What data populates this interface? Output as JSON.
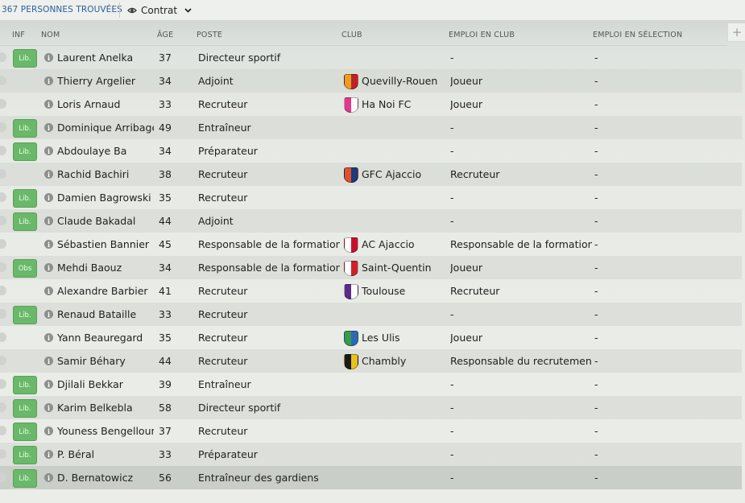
{
  "header": {
    "count_label": "367 PERSONNES TROUVÉES",
    "view_label": "Contrat",
    "add_column": "+"
  },
  "columns": {
    "inf": "INF",
    "nom": "NOM",
    "age": "ÂGE",
    "poste": "POSTE",
    "club": "CLUB",
    "emploi_club": "EMPLOI EN CLUB",
    "emploi_selection": "EMPLOI EN SÉLECTION"
  },
  "people": [
    {
      "badge": "Lib.",
      "name": "Laurent Anelka",
      "age": "37",
      "role": "Directeur sportif",
      "club": "",
      "club_icon": "",
      "club_colors": [],
      "club_job": "-",
      "nat_job": "-"
    },
    {
      "badge": "",
      "name": "Thierry Argelier",
      "age": "34",
      "role": "Adjoint",
      "club": "Quevilly-Rouen",
      "club_icon": "quevilly-rouen-crest-icon",
      "club_colors": [
        "#e8a020",
        "#c0202a"
      ],
      "club_job": "Joueur",
      "nat_job": "-"
    },
    {
      "badge": "",
      "name": "Loris Arnaud",
      "age": "33",
      "role": "Recruteur",
      "club": "Ha Noi FC",
      "club_icon": "ha-noi-fc-crest-icon",
      "club_colors": [
        "#e23a8a",
        "#ffffff"
      ],
      "club_job": "Joueur",
      "nat_job": "-"
    },
    {
      "badge": "Lib.",
      "name": "Dominique Arribagé",
      "age": "49",
      "role": "Entraîneur",
      "club": "",
      "club_icon": "",
      "club_colors": [],
      "club_job": "-",
      "nat_job": "-"
    },
    {
      "badge": "Lib.",
      "name": "Abdoulaye Ba",
      "age": "34",
      "role": "Préparateur",
      "club": "",
      "club_icon": "",
      "club_colors": [],
      "club_job": "-",
      "nat_job": "-"
    },
    {
      "badge": "",
      "name": "Rachid Bachiri",
      "age": "38",
      "role": "Recruteur",
      "club": "GFC Ajaccio",
      "club_icon": "gfc-ajaccio-crest-icon",
      "club_colors": [
        "#e0502a",
        "#1d3b7a"
      ],
      "club_job": "Recruteur",
      "nat_job": "-"
    },
    {
      "badge": "Lib.",
      "name": "Damien Bagrowski",
      "age": "35",
      "role": "Recruteur",
      "club": "",
      "club_icon": "",
      "club_colors": [],
      "club_job": "-",
      "nat_job": "-"
    },
    {
      "badge": "Lib.",
      "name": "Claude Bakadal",
      "age": "44",
      "role": "Adjoint",
      "club": "",
      "club_icon": "",
      "club_colors": [],
      "club_job": "-",
      "nat_job": "-"
    },
    {
      "badge": "",
      "name": "Sébastien Bannier",
      "age": "45",
      "role": "Responsable de la formation j...",
      "club": "AC Ajaccio",
      "club_icon": "ac-ajaccio-crest-icon",
      "club_colors": [
        "#ffffff",
        "#c8102e"
      ],
      "club_job": "Responsable de la formation j...",
      "nat_job": "-"
    },
    {
      "badge": "Obs",
      "name": "Mehdi Baouz",
      "age": "34",
      "role": "Responsable de la formation j...",
      "club": "Saint-Quentin",
      "club_icon": "saint-quentin-crest-icon",
      "club_colors": [
        "#ffffff",
        "#d0202a"
      ],
      "club_job": "Joueur",
      "nat_job": "-"
    },
    {
      "badge": "",
      "name": "Alexandre Barbier",
      "age": "41",
      "role": "Recruteur",
      "club": "Toulouse",
      "club_icon": "toulouse-crest-icon",
      "club_colors": [
        "#5b2c8a",
        "#ffffff"
      ],
      "club_job": "Recruteur",
      "nat_job": "-"
    },
    {
      "badge": "Lib.",
      "name": "Renaud Bataille",
      "age": "33",
      "role": "Recruteur",
      "club": "",
      "club_icon": "",
      "club_colors": [],
      "club_job": "-",
      "nat_job": "-"
    },
    {
      "badge": "",
      "name": "Yann Beauregard",
      "age": "35",
      "role": "Recruteur",
      "club": "Les Ulis",
      "club_icon": "les-ulis-crest-icon",
      "club_colors": [
        "#3a9a4a",
        "#2a6ab8"
      ],
      "club_job": "Joueur",
      "nat_job": "-"
    },
    {
      "badge": "",
      "name": "Samir Béhary",
      "age": "44",
      "role": "Recruteur",
      "club": "Chambly",
      "club_icon": "chambly-crest-icon",
      "club_colors": [
        "#1a1a1a",
        "#e8c020"
      ],
      "club_job": "Responsable du recrutement",
      "nat_job": "-"
    },
    {
      "badge": "Lib.",
      "name": "Djilali Bekkar",
      "age": "39",
      "role": "Entraîneur",
      "club": "",
      "club_icon": "",
      "club_colors": [],
      "club_job": "-",
      "nat_job": "-"
    },
    {
      "badge": "Lib.",
      "name": "Karim Belkebla",
      "age": "58",
      "role": "Directeur sportif",
      "club": "",
      "club_icon": "",
      "club_colors": [],
      "club_job": "-",
      "nat_job": "-"
    },
    {
      "badge": "Lib.",
      "name": "Youness Bengelloun",
      "age": "37",
      "role": "Recruteur",
      "club": "",
      "club_icon": "",
      "club_colors": [],
      "club_job": "-",
      "nat_job": "-"
    },
    {
      "badge": "Lib.",
      "name": "P. Béral",
      "age": "33",
      "role": "Préparateur",
      "club": "",
      "club_icon": "",
      "club_colors": [],
      "club_job": "-",
      "nat_job": "-"
    },
    {
      "badge": "Lib.",
      "name": "D. Bernatowicz",
      "age": "56",
      "role": "Entraîneur des gardiens",
      "club": "",
      "club_icon": "",
      "club_colors": [],
      "club_job": "-",
      "nat_job": "-"
    }
  ]
}
